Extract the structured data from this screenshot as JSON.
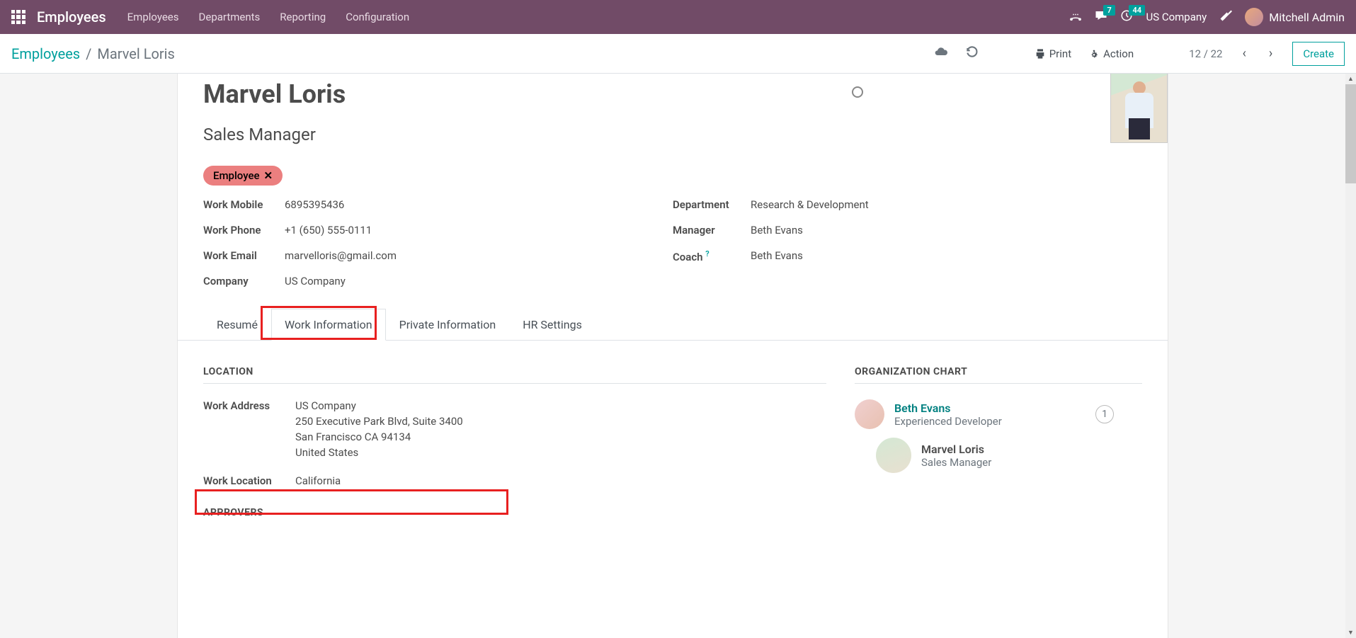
{
  "nav": {
    "app_title": "Employees",
    "menus": [
      "Employees",
      "Departments",
      "Reporting",
      "Configuration"
    ],
    "msg_badge": "7",
    "activity_badge": "44",
    "company": "US Company",
    "user": "Mitchell Admin"
  },
  "control": {
    "breadcrumb_root": "Employees",
    "breadcrumb_current": "Marvel Loris",
    "print": "Print",
    "action": "Action",
    "pager": "12 / 22",
    "create": "Create"
  },
  "employee": {
    "name": "Marvel Loris",
    "job_title": "Sales Manager",
    "tag": "Employee",
    "left": {
      "work_mobile_l": "Work Mobile",
      "work_mobile": "6895395436",
      "work_phone_l": "Work Phone",
      "work_phone": "+1 (650) 555-0111",
      "work_email_l": "Work Email",
      "work_email": "marvelloris@gmail.com",
      "company_l": "Company",
      "company": "US Company"
    },
    "right": {
      "department_l": "Department",
      "department": "Research & Development",
      "manager_l": "Manager",
      "manager": "Beth Evans",
      "coach_l": "Coach",
      "coach": "Beth Evans"
    }
  },
  "tabs": {
    "resume": "Resumé",
    "work_info": "Work Information",
    "private_info": "Private Information",
    "hr_settings": "HR Settings"
  },
  "work_info": {
    "location_head": "LOCATION",
    "addr_label": "Work Address",
    "addr1": "US Company",
    "addr2": "250 Executive Park Blvd, Suite 3400",
    "addr3": "San Francisco CA 94134",
    "addr4": "United States",
    "loc_label": "Work Location",
    "loc_val": "California",
    "approvers_head": "APPROVERS"
  },
  "org": {
    "head": "ORGANIZATION CHART",
    "manager_name": "Beth Evans",
    "manager_title": "Experienced Developer",
    "manager_count": "1",
    "self_name": "Marvel Loris",
    "self_title": "Sales Manager"
  }
}
